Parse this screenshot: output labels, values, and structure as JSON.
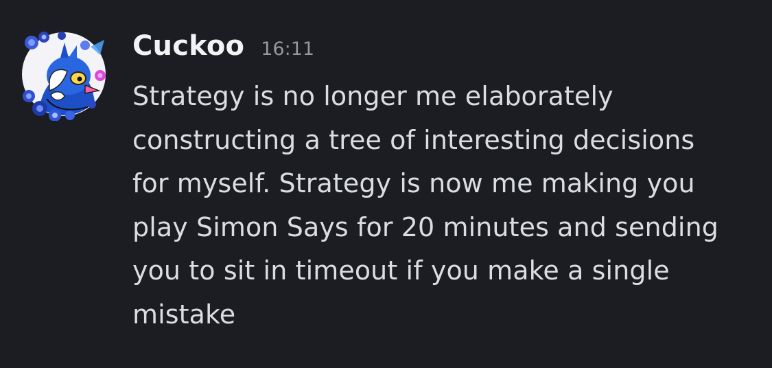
{
  "message": {
    "author": "Cuckoo",
    "timestamp": "16:11",
    "avatar_icon": "user-avatar-blue-bird-flowers",
    "lines": [
      "Strategy is no longer me elaborately",
      "constructing a tree of interesting decisions",
      "for myself. Strategy is now me making you",
      "play Simon Says for 20 minutes and sending",
      "you to sit in timeout if you make a single",
      "mistake"
    ]
  },
  "colors": {
    "background": "#1c1d22",
    "username": "#f2f3f5",
    "timestamp": "#96989d",
    "text": "#dbdee1"
  }
}
